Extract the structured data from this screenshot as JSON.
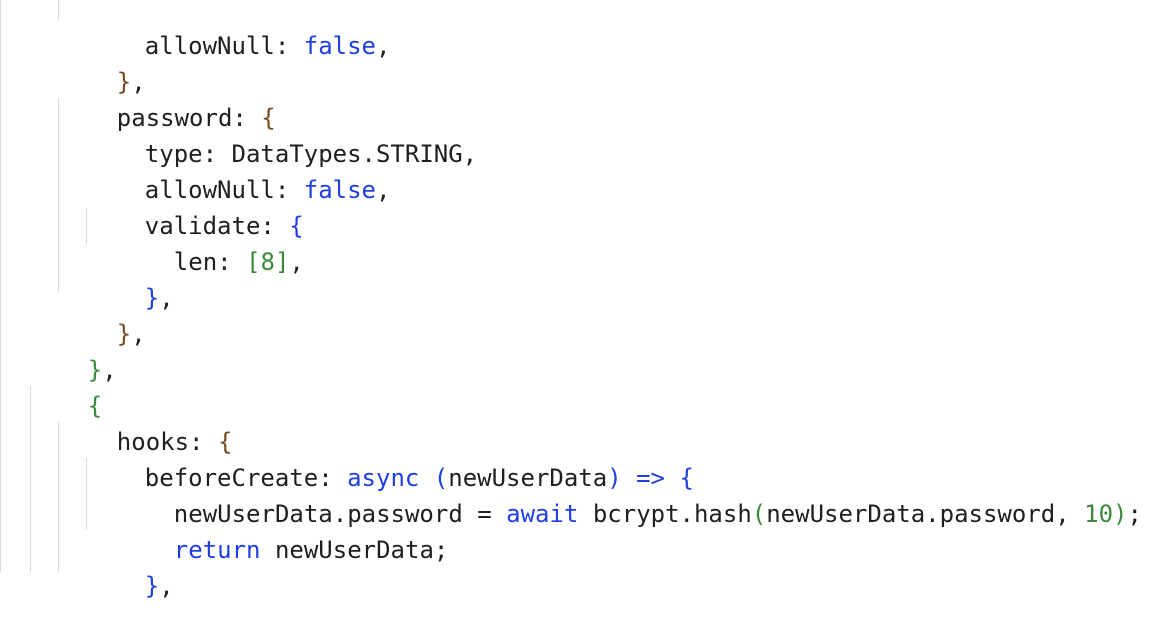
{
  "code": {
    "l1": {
      "ident": "allowNull",
      "colon": ": ",
      "value": "false",
      "comma": ","
    },
    "l2": {
      "brace": "}",
      "comma": ","
    },
    "l3": {
      "ident": "password",
      "colon": ": ",
      "brace": "{"
    },
    "l4": {
      "text": "type: DataTypes.STRING,"
    },
    "l5": {
      "ident": "allowNull",
      "colon": ": ",
      "value": "false",
      "comma": ","
    },
    "l6": {
      "ident": "validate",
      "colon": ": ",
      "brace": "{"
    },
    "l7": {
      "ident": "len",
      "colon": ": ",
      "open": "[",
      "num": "8",
      "close": "]",
      "comma": ","
    },
    "l8": {
      "brace": "}",
      "comma": ","
    },
    "l9": {
      "brace": "}",
      "comma": ","
    },
    "l10": {
      "brace": "}",
      "comma": ","
    },
    "l11": {
      "brace": "{"
    },
    "l12": {
      "ident": "hooks",
      "colon": ": ",
      "brace": "{"
    },
    "l13": {
      "ident": "beforeCreate",
      "colon": ": ",
      "kw": "async",
      "sp": " ",
      "open": "(",
      "param": "newUserData",
      "close": ")",
      "arrow": " => ",
      "brace": "{"
    },
    "l14": {
      "lhs": "newUserData.password = ",
      "kw": "await",
      "call": " bcrypt.hash",
      "open": "(",
      "args": "newUserData.password, ",
      "num": "10",
      "close": ")",
      "semi": ";"
    },
    "l15": {
      "kw": "return",
      "rest": " newUserData;"
    },
    "l16": {
      "brace": "}",
      "comma": ","
    }
  }
}
